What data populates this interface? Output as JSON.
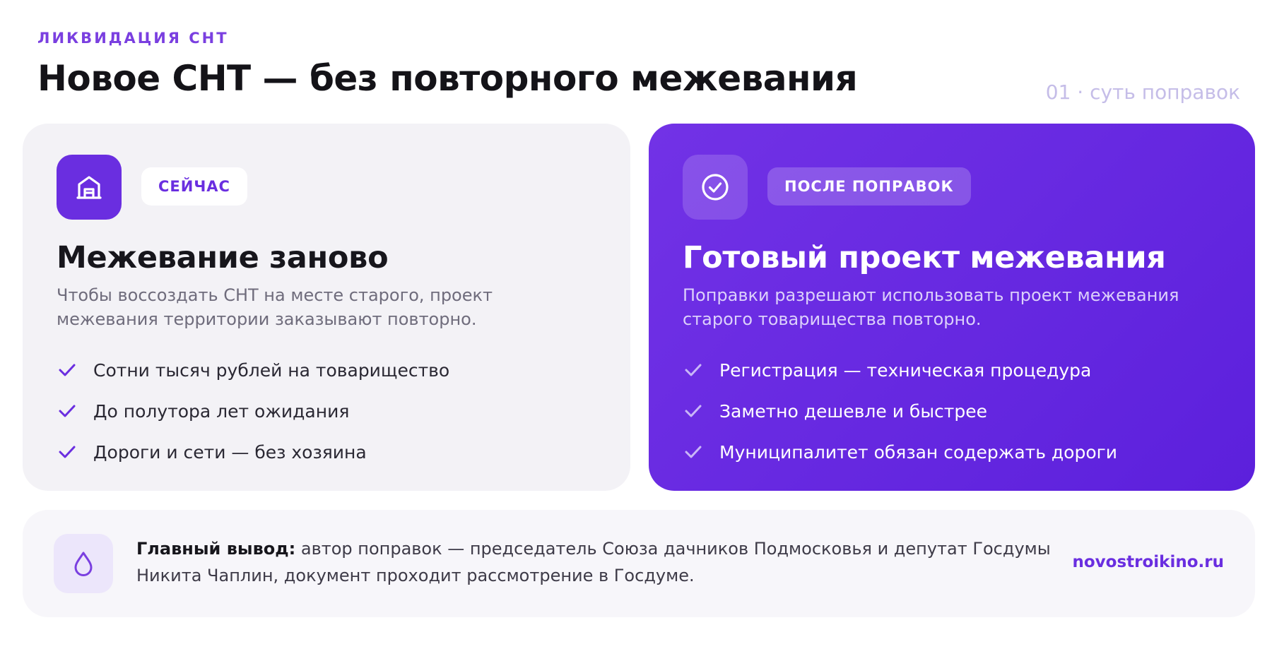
{
  "header": {
    "kicker": "ЛИКВИДАЦИЯ СНТ",
    "title": "Новое СНТ — без повторного межевания",
    "section_tag": "01 · суть поправок"
  },
  "colors": {
    "accent": "#6a2ee0",
    "card_right_gradient": [
      "#7232e6",
      "#5c20dc"
    ],
    "card_left_bg": "#f3f2f6",
    "bottom_bg": "#f7f6fa"
  },
  "card_now": {
    "icon": "house-icon",
    "badge": "СЕЙЧАС",
    "heading": "Межевание заново",
    "description": "Чтобы воссоздать СНТ на месте старого, проект межевания территории заказывают повторно.",
    "items": [
      "Сотни тысяч рублей на товарищество",
      "До полутора лет ожидания",
      "Дороги и сети — без хозяина"
    ]
  },
  "card_after": {
    "icon": "check-circle-icon",
    "badge": "ПОСЛЕ ПОПРАВОК",
    "heading": "Готовый проект межевания",
    "description": "Поправки разрешают использовать проект межевания старого товарищества повторно.",
    "items": [
      "Регистрация — техническая процедура",
      "Заметно дешевле и быстрее",
      "Муниципалитет обязан содержать дороги"
    ]
  },
  "bottom": {
    "icon": "drop-icon",
    "lead": "Главный вывод:",
    "text": " автор поправок — председатель Союза дачников Подмосковья и депутат Госдумы Никита Чаплин, документ проходит рассмотрение в Госдуме.",
    "site": "novostroikino.ru"
  }
}
